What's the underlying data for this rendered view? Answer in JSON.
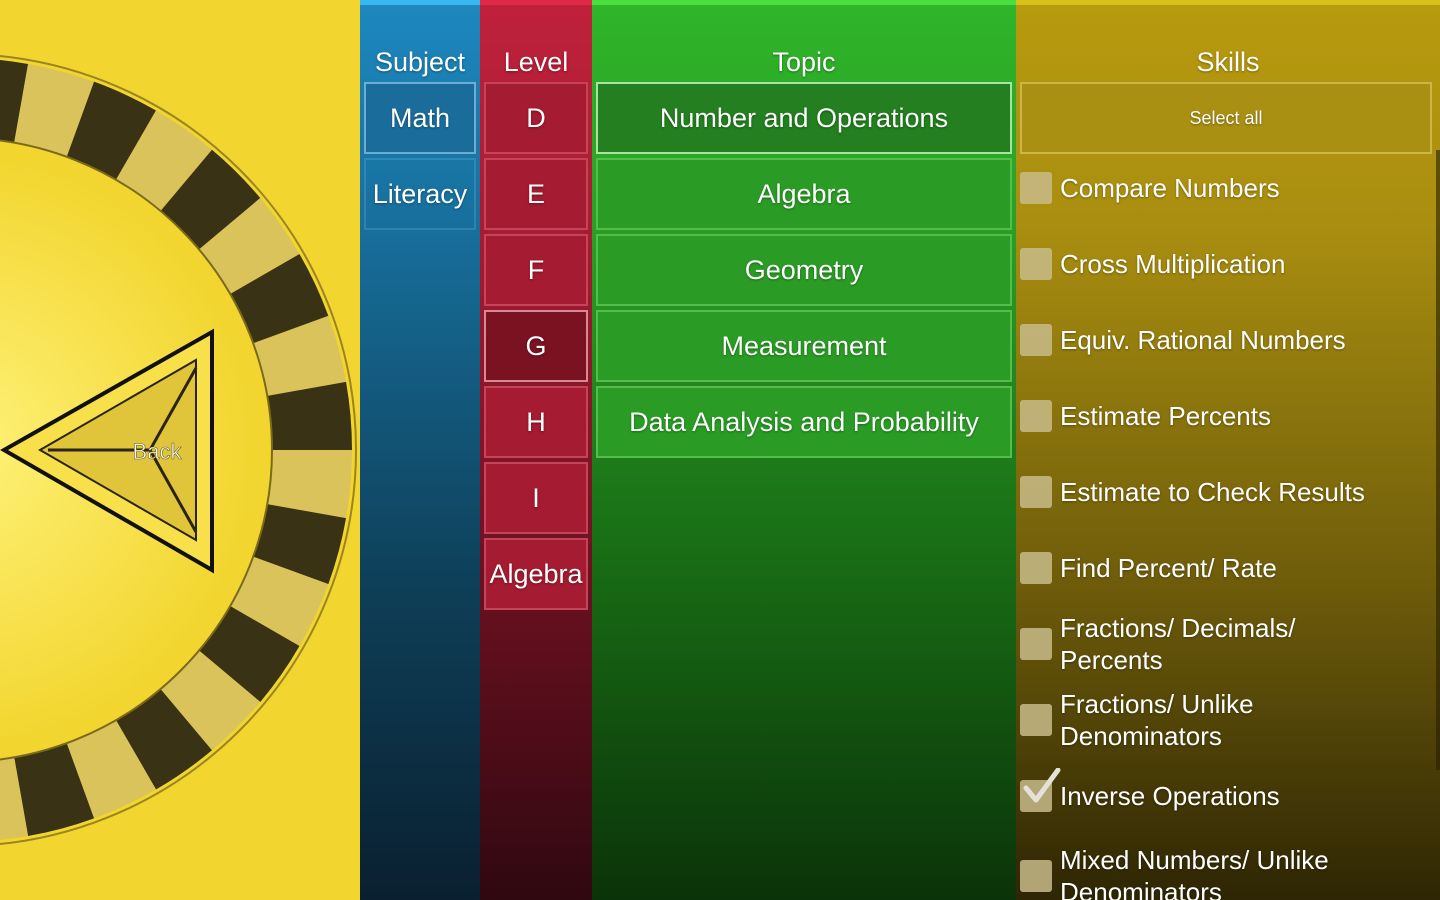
{
  "wheel": {
    "back_label": "Back",
    "colors": {
      "background": "#f2d52e",
      "checker_dark": "#3a3214",
      "checker_light": "#d9c35a"
    }
  },
  "subject": {
    "header": "Subject",
    "items": [
      {
        "label": "Math",
        "selected": true
      },
      {
        "label": "Literacy",
        "selected": false
      }
    ]
  },
  "level": {
    "header": "Level",
    "items": [
      {
        "label": "D",
        "selected": false
      },
      {
        "label": "E",
        "selected": false
      },
      {
        "label": "F",
        "selected": false
      },
      {
        "label": "G",
        "selected": true
      },
      {
        "label": "H",
        "selected": false
      },
      {
        "label": "I",
        "selected": false
      },
      {
        "label": "Algebra",
        "selected": false
      }
    ]
  },
  "topic": {
    "header": "Topic",
    "items": [
      {
        "label": "Number and Operations",
        "selected": true
      },
      {
        "label": "Algebra",
        "selected": false
      },
      {
        "label": "Geometry",
        "selected": false
      },
      {
        "label": "Measurement",
        "selected": false
      },
      {
        "label": "Data Analysis and Probability",
        "selected": false
      }
    ]
  },
  "skills": {
    "header": "Skills",
    "select_all_label": "Select all",
    "items": [
      {
        "label": "Compare Numbers",
        "checked": false
      },
      {
        "label": "Cross Multiplication",
        "checked": false
      },
      {
        "label": "Equiv. Rational Numbers",
        "checked": false
      },
      {
        "label": "Estimate Percents",
        "checked": false
      },
      {
        "label": "Estimate to Check Results",
        "checked": false
      },
      {
        "label": "Find Percent/ Rate",
        "checked": false
      },
      {
        "label": "Fractions/ Decimals/ Percents",
        "checked": false
      },
      {
        "label": "Fractions/ Unlike Denominators",
        "checked": false
      },
      {
        "label": "Inverse Operations",
        "checked": true
      },
      {
        "label": "Mixed Numbers/ Unlike Denominators",
        "checked": false
      }
    ]
  }
}
